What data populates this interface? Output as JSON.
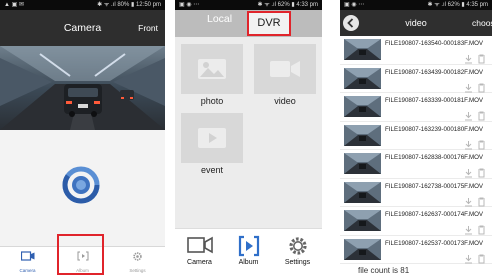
{
  "phone1": {
    "status": {
      "left": "▲ ▣ ✉",
      "right": "✱ ᯤ .ıl 80% ▮ 12:50 pm"
    },
    "header": {
      "title": "Camera",
      "front_label": "Front"
    },
    "tabs": [
      {
        "label": "Camera",
        "icon": "camera-icon",
        "active": true
      },
      {
        "label": "Album",
        "icon": "album-icon",
        "active": false
      },
      {
        "label": "Settings",
        "icon": "settings-gear-icon",
        "active": false
      }
    ],
    "colors": {
      "header": "#2e2e2e",
      "accent": "#2f5fb0",
      "highlight": "#e0242b"
    }
  },
  "phone2": {
    "status": {
      "left": "▣ ◉ ⋯",
      "right": "✱ ᯤ .ıl 62% ▮ 4:33 pm"
    },
    "tabs_top": {
      "local": "Local",
      "dvr": "DVR"
    },
    "tiles": [
      {
        "label": "photo",
        "icon": "photo-icon"
      },
      {
        "label": "video",
        "icon": "video-camera-icon"
      },
      {
        "label": "event",
        "icon": "event-icon"
      }
    ],
    "tabs": [
      {
        "label": "Camera",
        "icon": "camera-icon"
      },
      {
        "label": "Album",
        "icon": "album-icon"
      },
      {
        "label": "Settings",
        "icon": "settings-gear-icon"
      }
    ]
  },
  "phone3": {
    "status": {
      "left": "▣ ◉ ⋯",
      "right": "✱ ᯤ .ıl 62% ▮ 4:35 pm"
    },
    "header": {
      "title": "video",
      "choose_label": "choose"
    },
    "files": [
      "FILE190807-163540-000183F.MOV",
      "FILE190807-163439-000182F.MOV",
      "FILE190807-163339-000181F.MOV",
      "FILE190807-163239-000180F.MOV",
      "FILE190807-162838-000176F.MOV",
      "FILE190807-162738-000175F.MOV",
      "FILE190807-162637-000174F.MOV",
      "FILE190807-162537-000173F.MOV"
    ],
    "file_count": "file count is  81"
  }
}
